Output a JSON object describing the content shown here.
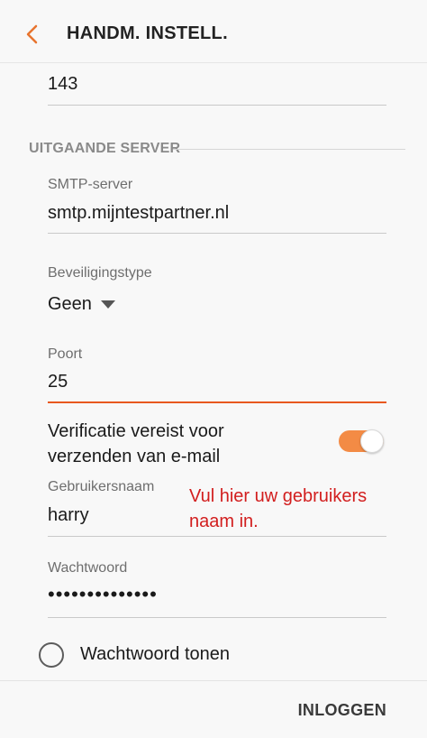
{
  "header": {
    "back_icon": "chevron-left-icon",
    "title": "HANDM. INSTELL."
  },
  "incoming_port": {
    "value": "143"
  },
  "section": {
    "title": "UITGAANDE SERVER"
  },
  "smtp": {
    "label": "SMTP-server",
    "value": "smtp.mijntestpartner.nl"
  },
  "security": {
    "label": "Beveiligingstype",
    "value": "Geen"
  },
  "port": {
    "label": "Poort",
    "value": "25"
  },
  "verification": {
    "line1": "Verificatie vereist voor",
    "line2": "verzenden van e-mail",
    "enabled": true
  },
  "username": {
    "label": "Gebruikersnaam",
    "value": "harry"
  },
  "annotation": {
    "line1": "Vul hier uw gebruikers",
    "line2": "naam in."
  },
  "password": {
    "label": "Wachtwoord",
    "value": "••••••••••••••"
  },
  "show_password": {
    "label": "Wachtwoord tonen",
    "checked": false
  },
  "footer": {
    "login_label": "INLOGGEN"
  },
  "colors": {
    "accent": "#e8581e",
    "toggle_on": "#f38b45",
    "annotation": "#d21e1e"
  }
}
